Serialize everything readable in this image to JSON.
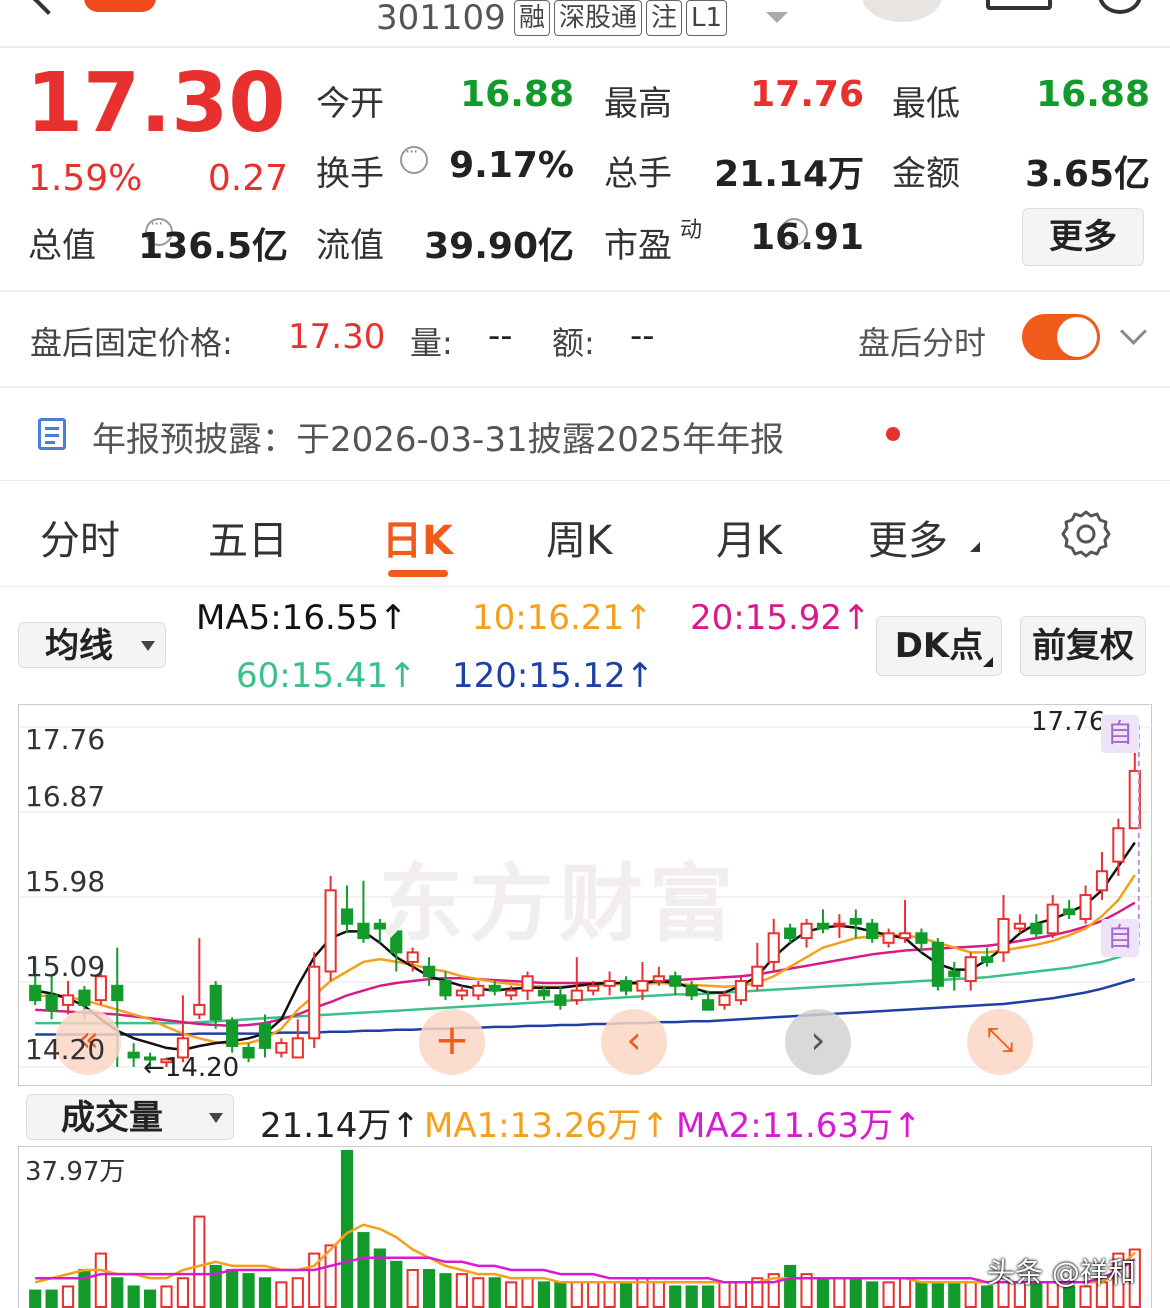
{
  "header": {
    "code": "301109",
    "tags": [
      "融",
      "深股通",
      "注",
      "L1"
    ]
  },
  "quote": {
    "price": "17.30",
    "pct": "1.59%",
    "chg": "0.27",
    "open_label": "今开",
    "open": "16.88",
    "high_label": "最高",
    "high": "17.76",
    "low_label": "最低",
    "low": "16.88",
    "turnover_label": "换手",
    "turnover": "9.17%",
    "vol_label": "总手",
    "vol": "21.14万",
    "amount_label": "金额",
    "amount": "3.65亿",
    "mcap_label": "总值",
    "mcap": "136.5亿",
    "float_label": "流值",
    "float": "39.90亿",
    "pe_label": "市盈",
    "pe_sup": "动",
    "pe": "16.91",
    "more": "更多"
  },
  "after_hours": {
    "label": "盘后固定价格:",
    "price": "17.30",
    "vol_label": "量:",
    "vol": "--",
    "amt_label": "额:",
    "amt": "--",
    "intraday_label": "盘后分时",
    "toggle_on": true
  },
  "notice": {
    "text": "年报预披露：于2026-03-31披露2025年年报"
  },
  "tabs": [
    "分时",
    "五日",
    "日K",
    "周K",
    "月K",
    "更多"
  ],
  "active_tab": "日K",
  "ma_bar": {
    "selector": "均线",
    "ma5": "MA5:16.55",
    "ma10": "10:16.21",
    "ma20": "20:15.92",
    "ma60": "60:15.41",
    "ma120": "120:15.12",
    "dk_btn": "DK点",
    "adj_btn": "前复权"
  },
  "vol_bar": {
    "selector": "成交量",
    "vol": "21.14万",
    "ma1": "MA1:13.26万",
    "ma2": "MA2:11.63万"
  },
  "watermark": {
    "brand": "东方财富",
    "credit": "头条 @祥和"
  },
  "colors": {
    "up": "#e8312f",
    "down": "#129b2a",
    "accent": "#f05a1a",
    "ma5": "#111111",
    "ma10": "#f5a01a",
    "ma20": "#d81b8a",
    "ma60": "#3cc08a",
    "ma120": "#1e3fa6"
  },
  "chart_data": {
    "type": "candlestick",
    "price_axis_labels": [
      "17.76",
      "16.87",
      "15.98",
      "15.09",
      "14.20"
    ],
    "ylim": [
      14.2,
      17.76
    ],
    "high_mark": "17.76",
    "low_mark": "14.20",
    "self_markers": [
      "自",
      "自"
    ],
    "candles": [
      [
        15.05,
        14.9,
        15.35,
        14.85
      ],
      [
        14.95,
        14.8,
        15.15,
        14.7
      ],
      [
        14.85,
        14.95,
        15.1,
        14.75
      ],
      [
        15.0,
        14.85,
        15.05,
        14.7
      ],
      [
        14.9,
        15.15,
        15.2,
        14.85
      ],
      [
        15.05,
        14.9,
        15.45,
        14.2
      ],
      [
        14.35,
        14.3,
        14.45,
        14.2
      ],
      [
        14.3,
        14.28,
        14.35,
        14.2
      ],
      [
        14.25,
        14.28,
        14.3,
        14.2
      ],
      [
        14.3,
        14.5,
        14.95,
        14.25
      ],
      [
        14.75,
        14.85,
        15.55,
        14.7
      ],
      [
        15.05,
        14.7,
        15.1,
        14.6
      ],
      [
        14.68,
        14.42,
        14.72,
        14.35
      ],
      [
        14.4,
        14.3,
        14.45,
        14.25
      ],
      [
        14.65,
        14.4,
        14.75,
        14.3
      ],
      [
        14.35,
        14.45,
        14.5,
        14.3
      ],
      [
        14.3,
        14.5,
        14.7,
        14.3
      ],
      [
        14.5,
        15.25,
        15.4,
        14.4
      ],
      [
        15.2,
        16.05,
        16.2,
        15.1
      ],
      [
        15.85,
        15.7,
        16.1,
        15.6
      ],
      [
        15.7,
        15.55,
        16.15,
        15.5
      ],
      [
        15.7,
        15.65,
        15.75,
        15.5
      ],
      [
        15.62,
        15.4,
        15.65,
        15.2
      ],
      [
        15.3,
        15.4,
        15.45,
        15.2
      ],
      [
        15.25,
        15.15,
        15.35,
        15.05
      ],
      [
        15.1,
        14.95,
        15.2,
        14.9
      ],
      [
        14.95,
        15.0,
        15.05,
        14.9
      ],
      [
        14.95,
        15.05,
        15.1,
        14.9
      ],
      [
        15.05,
        15.0,
        15.1,
        14.95
      ],
      [
        14.95,
        15.0,
        15.05,
        14.9
      ],
      [
        15.0,
        15.15,
        15.2,
        14.9
      ],
      [
        15.0,
        14.95,
        15.05,
        14.9
      ],
      [
        14.95,
        14.85,
        15.05,
        14.8
      ],
      [
        14.9,
        15.0,
        15.35,
        14.85
      ],
      [
        15.0,
        15.05,
        15.1,
        14.95
      ],
      [
        15.05,
        15.1,
        15.2,
        14.95
      ],
      [
        15.1,
        15.0,
        15.15,
        14.95
      ],
      [
        15.0,
        15.1,
        15.3,
        14.9
      ],
      [
        15.1,
        15.15,
        15.25,
        15.05
      ],
      [
        15.15,
        15.05,
        15.2,
        14.95
      ],
      [
        15.05,
        14.95,
        15.1,
        14.9
      ],
      [
        14.9,
        14.8,
        15.0,
        14.8
      ],
      [
        14.85,
        14.95,
        15.0,
        14.8
      ],
      [
        14.9,
        15.1,
        15.15,
        14.85
      ],
      [
        15.05,
        15.25,
        15.5,
        15.0
      ],
      [
        15.3,
        15.6,
        15.75,
        15.2
      ],
      [
        15.65,
        15.55,
        15.7,
        15.5
      ],
      [
        15.55,
        15.7,
        15.75,
        15.45
      ],
      [
        15.7,
        15.65,
        15.85,
        15.6
      ],
      [
        15.7,
        15.7,
        15.8,
        15.55
      ],
      [
        15.75,
        15.7,
        15.85,
        15.55
      ],
      [
        15.7,
        15.55,
        15.75,
        15.5
      ],
      [
        15.5,
        15.6,
        15.65,
        15.45
      ],
      [
        15.55,
        15.6,
        15.95,
        15.5
      ],
      [
        15.6,
        15.5,
        15.65,
        15.4
      ],
      [
        15.5,
        15.05,
        15.55,
        15.0
      ],
      [
        15.2,
        15.15,
        15.3,
        15.0
      ],
      [
        15.1,
        15.35,
        15.4,
        15.0
      ],
      [
        15.35,
        15.3,
        15.45,
        15.25
      ],
      [
        15.4,
        15.75,
        16.0,
        15.3
      ],
      [
        15.65,
        15.7,
        15.8,
        15.6
      ],
      [
        15.7,
        15.6,
        15.8,
        15.55
      ],
      [
        15.6,
        15.9,
        16.0,
        15.55
      ],
      [
        15.85,
        15.8,
        15.95,
        15.75
      ],
      [
        15.75,
        16.0,
        16.1,
        15.7
      ],
      [
        16.05,
        16.25,
        16.45,
        15.95
      ],
      [
        16.35,
        16.7,
        16.8,
        16.2
      ],
      [
        16.7,
        17.3,
        17.76,
        16.88
      ]
    ],
    "ma5": [
      15.0,
      14.97,
      14.92,
      14.84,
      14.7,
      14.58,
      14.5,
      14.45,
      14.4,
      14.38,
      14.42,
      14.45,
      14.47,
      14.5,
      14.55,
      14.7,
      15.05,
      15.35,
      15.55,
      15.62,
      15.62,
      15.5,
      15.35,
      15.25,
      15.15,
      15.1,
      15.05,
      15.02,
      15.0,
      15.02,
      15.03,
      15.03,
      15.03,
      15.05,
      15.07,
      15.08,
      15.08,
      15.08,
      15.1,
      15.08,
      15.03,
      14.98,
      14.98,
      15.05,
      15.15,
      15.35,
      15.5,
      15.62,
      15.66,
      15.68,
      15.66,
      15.62,
      15.58,
      15.55,
      15.4,
      15.28,
      15.22,
      15.22,
      15.32,
      15.45,
      15.6,
      15.7,
      15.75,
      15.82,
      15.9,
      16.05,
      16.3,
      16.55
    ],
    "ma10": [
      14.95,
      14.94,
      14.93,
      14.9,
      14.85,
      14.8,
      14.75,
      14.7,
      14.62,
      14.55,
      14.5,
      14.46,
      14.44,
      14.45,
      14.5,
      14.6,
      14.8,
      14.95,
      15.1,
      15.2,
      15.3,
      15.33,
      15.3,
      15.27,
      15.23,
      15.2,
      15.15,
      15.12,
      15.09,
      15.07,
      15.05,
      15.04,
      15.04,
      15.05,
      15.06,
      15.06,
      15.07,
      15.07,
      15.08,
      15.07,
      15.06,
      15.05,
      15.04,
      15.05,
      15.08,
      15.15,
      15.25,
      15.35,
      15.45,
      15.5,
      15.55,
      15.57,
      15.58,
      15.58,
      15.55,
      15.5,
      15.45,
      15.4,
      15.4,
      15.42,
      15.45,
      15.48,
      15.52,
      15.58,
      15.65,
      15.78,
      15.95,
      16.21
    ],
    "ma20": [
      14.8,
      14.79,
      14.78,
      14.77,
      14.76,
      14.75,
      14.73,
      14.71,
      14.69,
      14.67,
      14.65,
      14.64,
      14.63,
      14.64,
      14.66,
      14.7,
      14.75,
      14.82,
      14.88,
      14.95,
      15.0,
      15.05,
      15.08,
      15.1,
      15.12,
      15.13,
      15.13,
      15.12,
      15.11,
      15.1,
      15.09,
      15.08,
      15.08,
      15.08,
      15.08,
      15.08,
      15.08,
      15.09,
      15.1,
      15.11,
      15.12,
      15.13,
      15.14,
      15.15,
      15.17,
      15.2,
      15.23,
      15.26,
      15.29,
      15.32,
      15.35,
      15.38,
      15.4,
      15.42,
      15.43,
      15.44,
      15.45,
      15.46,
      15.47,
      15.49,
      15.52,
      15.55,
      15.58,
      15.62,
      15.67,
      15.73,
      15.82,
      15.92
    ],
    "ma60": [
      14.66,
      14.66,
      14.66,
      14.66,
      14.66,
      14.66,
      14.66,
      14.66,
      14.66,
      14.66,
      14.67,
      14.68,
      14.69,
      14.7,
      14.71,
      14.72,
      14.73,
      14.74,
      14.75,
      14.76,
      14.77,
      14.78,
      14.79,
      14.8,
      14.81,
      14.82,
      14.83,
      14.84,
      14.85,
      14.86,
      14.87,
      14.88,
      14.89,
      14.9,
      14.91,
      14.92,
      14.93,
      14.94,
      14.95,
      14.96,
      14.96,
      14.97,
      14.98,
      14.99,
      15.0,
      15.01,
      15.02,
      15.03,
      15.04,
      15.05,
      15.06,
      15.07,
      15.08,
      15.09,
      15.1,
      15.11,
      15.12,
      15.13,
      15.14,
      15.16,
      15.18,
      15.2,
      15.22,
      15.24,
      15.27,
      15.3,
      15.35,
      15.41
    ],
    "ma120": [
      14.54,
      14.54,
      14.54,
      14.54,
      14.54,
      14.54,
      14.54,
      14.54,
      14.54,
      14.54,
      14.55,
      14.55,
      14.55,
      14.55,
      14.55,
      14.56,
      14.56,
      14.56,
      14.57,
      14.57,
      14.58,
      14.58,
      14.59,
      14.59,
      14.6,
      14.6,
      14.61,
      14.61,
      14.62,
      14.62,
      14.63,
      14.63,
      14.64,
      14.64,
      14.65,
      14.65,
      14.66,
      14.66,
      14.67,
      14.67,
      14.68,
      14.68,
      14.69,
      14.7,
      14.71,
      14.72,
      14.73,
      14.74,
      14.75,
      14.76,
      14.77,
      14.78,
      14.79,
      14.8,
      14.81,
      14.82,
      14.83,
      14.84,
      14.85,
      14.86,
      14.88,
      14.9,
      14.92,
      14.95,
      14.98,
      15.02,
      15.07,
      15.12
    ],
    "volume": {
      "axis_label": "37.97万",
      "ymax": 37.97,
      "values": [
        4,
        4,
        5,
        9,
        13,
        7,
        5,
        4,
        5,
        7,
        22,
        10,
        9,
        8,
        7,
        6,
        7,
        13,
        15,
        37.97,
        18,
        14,
        11,
        9,
        9,
        8,
        8,
        7,
        7,
        6,
        7,
        6,
        6,
        6,
        6,
        6,
        6,
        7,
        6,
        5,
        5,
        5,
        6,
        6,
        7,
        8,
        10,
        8,
        7,
        7,
        7,
        6,
        6,
        7,
        6,
        6,
        6,
        6,
        5,
        7,
        6,
        6,
        6,
        5,
        5,
        6,
        13,
        14
      ],
      "ma1": [
        6,
        7,
        8,
        9,
        9,
        8,
        8,
        7,
        7,
        9,
        10,
        11,
        10,
        10,
        10,
        9,
        9,
        10,
        14,
        18,
        20,
        19,
        17,
        14,
        12,
        10,
        9,
        8,
        8,
        7,
        7,
        7,
        6,
        6,
        6,
        6,
        6,
        6,
        6,
        6,
        6,
        6,
        6,
        6,
        6,
        7,
        7,
        7,
        7,
        7,
        7,
        7,
        7,
        7,
        6,
        6,
        6,
        6,
        6,
        6,
        6,
        6,
        6,
        6,
        6,
        6,
        9,
        13.26
      ],
      "ma2": [
        7,
        7,
        7,
        7,
        8,
        8,
        8,
        8,
        8,
        8,
        8,
        8,
        9,
        9,
        9,
        9,
        9,
        9,
        10,
        11,
        12,
        12,
        12,
        12,
        12,
        11,
        11,
        10,
        10,
        9,
        9,
        9,
        8,
        8,
        8,
        7,
        7,
        7,
        7,
        7,
        7,
        7,
        6,
        6,
        6,
        6,
        7,
        7,
        7,
        7,
        7,
        7,
        7,
        7,
        7,
        7,
        7,
        7,
        6,
        6,
        6,
        6,
        6,
        6,
        6,
        7,
        9,
        11.63
      ]
    }
  }
}
